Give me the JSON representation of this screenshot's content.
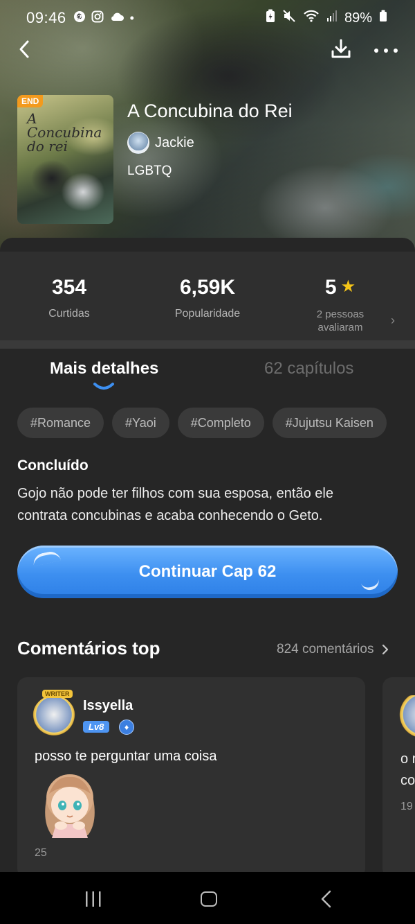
{
  "status_bar": {
    "time": "09:46",
    "battery": "89%"
  },
  "comic": {
    "badge": "END",
    "cover_title": "A Concubina do rei",
    "title": "A Concubina do Rei",
    "author": "Jackie",
    "genre": "LGBTQ"
  },
  "stats": {
    "likes_value": "354",
    "likes_label": "Curtidas",
    "popularity_value": "6,59K",
    "popularity_label": "Popularidade",
    "rating_value": "5",
    "rating_label_line1": "2 pessoas",
    "rating_label_line2": "avaliaram"
  },
  "tabs": {
    "details": "Mais detalhes",
    "chapters": "62 capítulos"
  },
  "tags": [
    "#Romance",
    "#Yaoi",
    "#Completo",
    "#Jujutsu Kaisen"
  ],
  "details": {
    "status": "Concluído",
    "description": "Gojo não pode ter filhos com sua esposa, então ele contrata concubinas e acaba conhecendo o Geto."
  },
  "continue_button": "Continuar Cap 62",
  "comments": {
    "heading": "Comentários top",
    "count": "824 comentários",
    "items": [
      {
        "badge": "WRITER",
        "user": "Issyella",
        "level": "Lv8",
        "text": "posso te perguntar uma coisa",
        "likes": "25"
      },
      {
        "text_line1": "o r",
        "text_line2": "co",
        "likes": "19"
      }
    ]
  },
  "colors": {
    "accent": "#3d8ff0",
    "star": "#f5c518",
    "background": "#262626"
  }
}
